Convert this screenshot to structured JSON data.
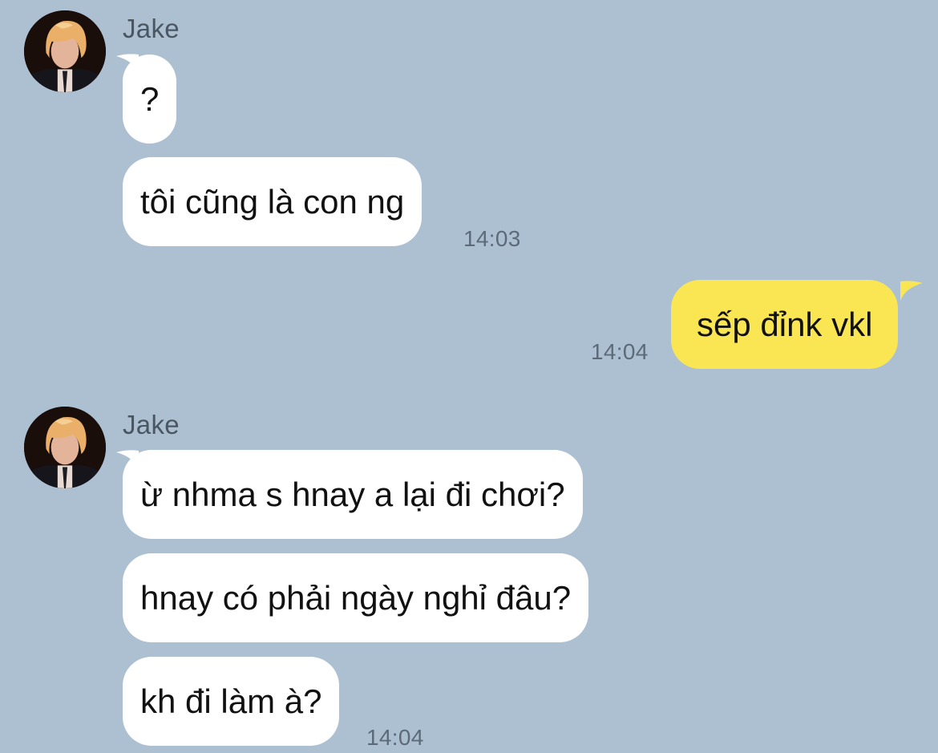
{
  "conversation": {
    "group_1": {
      "sender": "Jake",
      "messages": [
        "?",
        "tôi cũng là con ng"
      ],
      "time": "14:03"
    },
    "outgoing": {
      "message": "sếp đỉnk vkl",
      "time": "14:04"
    },
    "group_2": {
      "sender": "Jake",
      "messages": [
        "ừ nhma s hnay a lại đi chơi?",
        "hnay có phải ngày nghỉ đâu?",
        "kh đi làm à?"
      ],
      "time": "14:04"
    }
  },
  "colors": {
    "background": "#adc0d2",
    "incoming_bubble": "#ffffff",
    "outgoing_bubble": "#fae653",
    "timestamp": "#5c6a79",
    "sender_name": "#4b5663"
  },
  "icons": {
    "avatar": "profile-photo"
  }
}
